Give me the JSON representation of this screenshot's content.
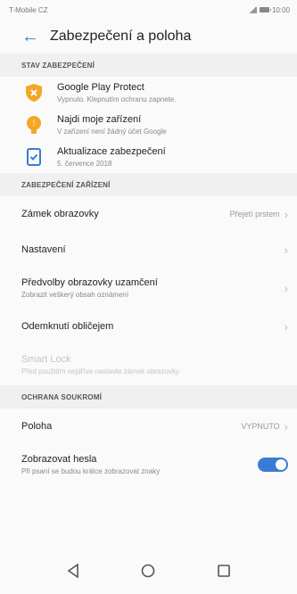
{
  "status_bar": {
    "carrier": "T-Mobile CZ",
    "time": "10:00"
  },
  "header": {
    "title": "Zabezpečení a poloha"
  },
  "sections": {
    "security_status": "STAV ZABEZPEČENÍ",
    "device_security": "ZABEZPEČENÍ ZAŘÍZENÍ",
    "privacy": "OCHRANA SOUKROMÍ"
  },
  "security_items": [
    {
      "title": "Google Play Protect",
      "subtitle": "Vypnuto. Klepnutím ochranu zapnete.",
      "icon": "shield-warning-icon"
    },
    {
      "title": "Najdi moje zařízení",
      "subtitle": "V zařízení není žádný účet Google",
      "icon": "find-device-icon"
    },
    {
      "title": "Aktualizace zabezpečení",
      "subtitle": "5. července 2018",
      "icon": "security-update-icon"
    }
  ],
  "device_items": {
    "screen_lock": {
      "title": "Zámek obrazovky",
      "value": "Přejetí prstem"
    },
    "settings": {
      "title": "Nastavení"
    },
    "lockscreen_prefs": {
      "title": "Předvolby obrazovky uzamčení",
      "subtitle": "Zobrazit veškerý obsah oznámení"
    },
    "face_unlock": {
      "title": "Odemknutí obličejem"
    },
    "smart_lock": {
      "title": "Smart Lock",
      "subtitle": "Před použitím nejdříve nastavte zámek obrazovky"
    }
  },
  "privacy_items": {
    "location": {
      "title": "Poloha",
      "value": "VYPNUTO"
    },
    "show_passwords": {
      "title": "Zobrazovat hesla",
      "subtitle": "Při psaní se budou krátce zobrazovat znaky",
      "toggle": true
    }
  },
  "colors": {
    "accent": "#3a7bd5",
    "warning": "#f5a623"
  }
}
